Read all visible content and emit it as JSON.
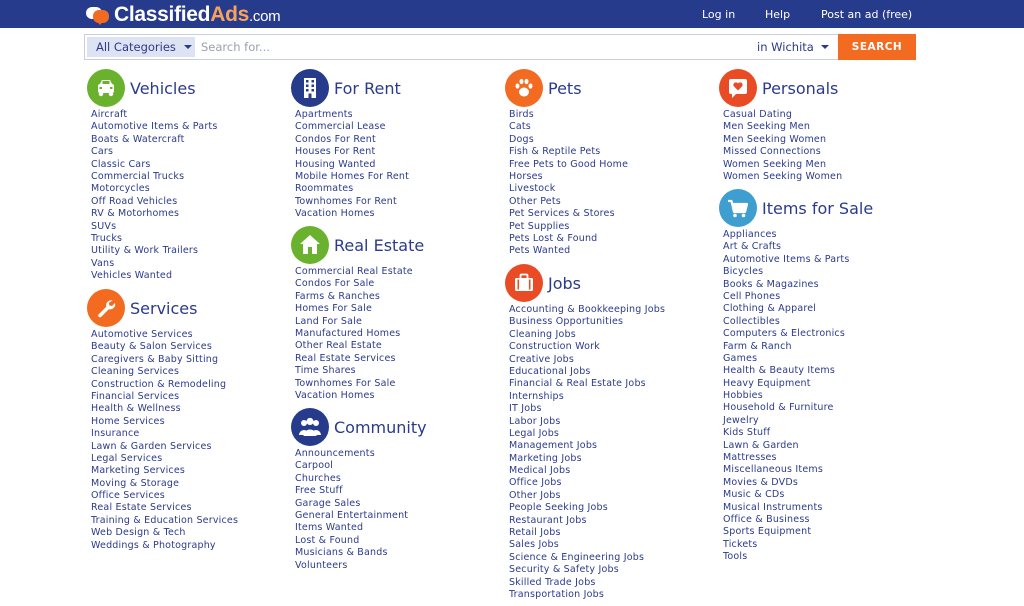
{
  "header": {
    "logo_main": "Classified",
    "logo_accent": "Ads",
    "logo_suffix": ".com",
    "nav": [
      {
        "label": "Log in"
      },
      {
        "label": "Help"
      },
      {
        "label": "Post an ad (free)"
      }
    ]
  },
  "search": {
    "category": "All Categories",
    "placeholder": "Search for...",
    "location": "in Wichita",
    "button": "SEARCH"
  },
  "categories": {
    "vehicles": {
      "title": "Vehicles",
      "icon": "car-icon",
      "items": [
        "Aircraft",
        "Automotive Items & Parts",
        "Boats & Watercraft",
        "Cars",
        "Classic Cars",
        "Commercial Trucks",
        "Motorcycles",
        "Off Road Vehicles",
        "RV & Motorhomes",
        "SUVs",
        "Trucks",
        "Utility & Work Trailers",
        "Vans",
        "Vehicles Wanted"
      ]
    },
    "services": {
      "title": "Services",
      "icon": "wrench-icon",
      "items": [
        "Automotive Services",
        "Beauty & Salon Services",
        "Caregivers & Baby Sitting",
        "Cleaning Services",
        "Construction & Remodeling",
        "Financial Services",
        "Health & Wellness",
        "Home Services",
        "Insurance",
        "Lawn & Garden Services",
        "Legal Services",
        "Marketing Services",
        "Moving & Storage",
        "Office Services",
        "Real Estate Services",
        "Training & Education Services",
        "Web Design & Tech",
        "Weddings & Photography"
      ]
    },
    "for_rent": {
      "title": "For Rent",
      "icon": "building-icon",
      "items": [
        "Apartments",
        "Commercial Lease",
        "Condos For Rent",
        "Houses For Rent",
        "Housing Wanted",
        "Mobile Homes For Rent",
        "Roommates",
        "Townhomes For Rent",
        "Vacation Homes"
      ]
    },
    "real_estate": {
      "title": "Real Estate",
      "icon": "house-icon",
      "items": [
        "Commercial Real Estate",
        "Condos For Sale",
        "Farms & Ranches",
        "Homes For Sale",
        "Land For Sale",
        "Manufactured Homes",
        "Other Real Estate",
        "Real Estate Services",
        "Time Shares",
        "Townhomes For Sale",
        "Vacation Homes"
      ]
    },
    "community": {
      "title": "Community",
      "icon": "people-icon",
      "items": [
        "Announcements",
        "Carpool",
        "Churches",
        "Free Stuff",
        "Garage Sales",
        "General Entertainment",
        "Items Wanted",
        "Lost & Found",
        "Musicians & Bands",
        "Volunteers"
      ]
    },
    "pets": {
      "title": "Pets",
      "icon": "paw-icon",
      "items": [
        "Birds",
        "Cats",
        "Dogs",
        "Fish & Reptile Pets",
        "Free Pets to Good Home",
        "Horses",
        "Livestock",
        "Other Pets",
        "Pet Services & Stores",
        "Pet Supplies",
        "Pets Lost & Found",
        "Pets Wanted"
      ]
    },
    "jobs": {
      "title": "Jobs",
      "icon": "briefcase-icon",
      "items": [
        "Accounting & Bookkeeping Jobs",
        "Business Opportunities",
        "Cleaning Jobs",
        "Construction Work",
        "Creative Jobs",
        "Educational Jobs",
        "Financial & Real Estate Jobs",
        "Internships",
        "IT Jobs",
        "Labor Jobs",
        "Legal Jobs",
        "Management Jobs",
        "Marketing Jobs",
        "Medical Jobs",
        "Office Jobs",
        "Other Jobs",
        "People Seeking Jobs",
        "Restaurant Jobs",
        "Retail Jobs",
        "Sales Jobs",
        "Science & Engineering Jobs",
        "Security & Safety Jobs",
        "Skilled Trade Jobs",
        "Transportation Jobs"
      ]
    },
    "personals": {
      "title": "Personals",
      "icon": "heart-chat-icon",
      "items": [
        "Casual Dating",
        "Men Seeking Men",
        "Men Seeking Women",
        "Missed Connections",
        "Women Seeking Men",
        "Women Seeking Women"
      ]
    },
    "items_for_sale": {
      "title": "Items for Sale",
      "icon": "cart-icon",
      "items": [
        "Appliances",
        "Art & Crafts",
        "Automotive Items & Parts",
        "Bicycles",
        "Books & Magazines",
        "Cell Phones",
        "Clothing & Apparel",
        "Collectibles",
        "Computers & Electronics",
        "Farm & Ranch",
        "Games",
        "Health & Beauty Items",
        "Heavy Equipment",
        "Hobbies",
        "Household & Furniture",
        "Jewelry",
        "Kids Stuff",
        "Lawn & Garden",
        "Mattresses",
        "Miscellaneous Items",
        "Movies & DVDs",
        "Music & CDs",
        "Musical Instruments",
        "Office & Business",
        "Sports Equipment",
        "Tickets",
        "Tools"
      ]
    }
  }
}
